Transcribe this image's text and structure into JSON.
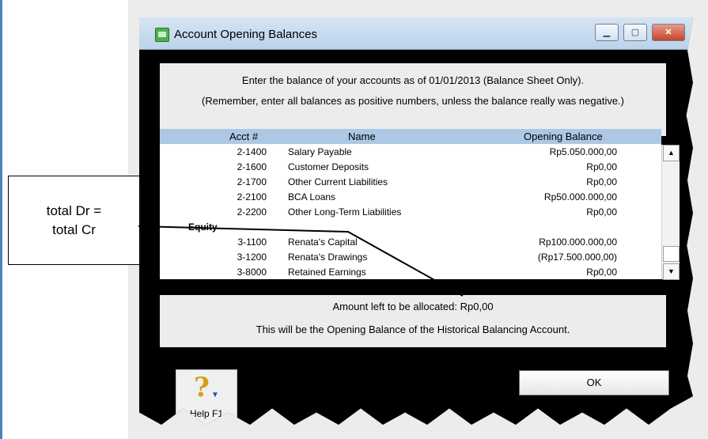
{
  "window": {
    "title": "Account Opening Balances",
    "controls": {
      "minimize": "▁",
      "maximize": "▢",
      "close": "✕"
    }
  },
  "instructions": {
    "line1": "Enter the balance of your accounts as of 01/01/2013 (Balance Sheet Only).",
    "line2": "(Remember, enter all balances as positive numbers, unless the balance really was negative.)"
  },
  "grid": {
    "columns": {
      "acct": "Acct #",
      "name": "Name",
      "balance": "Opening Balance"
    },
    "rows": [
      {
        "acct": "2-1400",
        "name": "Salary Payable",
        "balance": "Rp5.050.000,00"
      },
      {
        "acct": "2-1600",
        "name": "Customer Deposits",
        "balance": "Rp0,00"
      },
      {
        "acct": "2-1700",
        "name": "Other Current Liabilities",
        "balance": "Rp0,00"
      },
      {
        "acct": "2-2100",
        "name": "BCA Loans",
        "balance": "Rp50.000.000,00"
      },
      {
        "acct": "2-2200",
        "name": "Other Long-Term Liabilities",
        "balance": "Rp0,00"
      },
      {
        "section": "Equity"
      },
      {
        "acct": "3-1100",
        "name": "Renata's Capital",
        "balance": "Rp100.000.000,00"
      },
      {
        "acct": "3-1200",
        "name": "Renata's Drawings",
        "balance": "(Rp17.500.000,00)"
      },
      {
        "acct": "3-8000",
        "name": "Retained Earnings",
        "balance": "Rp0,00"
      }
    ]
  },
  "allocation": {
    "label": "Amount left to be allocated:",
    "value": "Rp0,00",
    "note": "This will be the Opening Balance of the Historical Balancing Account."
  },
  "buttons": {
    "help": "Help F1",
    "help_glyph": "?",
    "ok": "OK"
  },
  "annotation": {
    "line1": "total Dr =",
    "line2": "total Cr"
  },
  "icons": {
    "help": "help-question-icon",
    "app": "app-window-icon"
  },
  "colors": {
    "header": "#adc8e4",
    "titlebar": "#bcd3ea",
    "border": "#000000"
  }
}
